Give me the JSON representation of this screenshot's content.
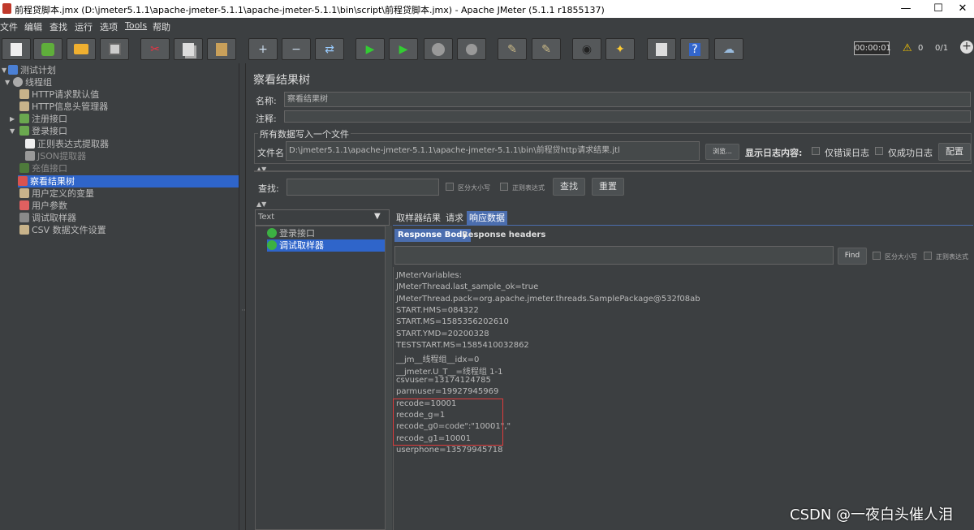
{
  "window": {
    "title": "前程贷脚本.jmx (D:\\jmeter5.1.1\\apache-jmeter-5.1.1\\apache-jmeter-5.1.1\\bin\\script\\前程贷脚本.jmx) - Apache JMeter (5.1.1 r1855137)",
    "minimize": "—",
    "maximize": "☐",
    "close": "✕"
  },
  "menu": [
    "文件",
    "编辑",
    "查找",
    "运行",
    "选项",
    "Tools",
    "帮助"
  ],
  "toolbar": {
    "timer": "00:00:01",
    "warning_count": "0",
    "threads": "0/1"
  },
  "tree": {
    "items": [
      {
        "label": "测试计划"
      },
      {
        "label": "线程组"
      },
      {
        "label": "HTTP请求默认值"
      },
      {
        "label": "HTTP信息头管理器"
      },
      {
        "label": "注册接口"
      },
      {
        "label": "登录接口"
      },
      {
        "label": "正则表达式提取器"
      },
      {
        "label": "JSON提取器"
      },
      {
        "label": "充值接口"
      },
      {
        "label": "察看结果树"
      },
      {
        "label": "用户定义的变量"
      },
      {
        "label": "用户参数"
      },
      {
        "label": "调试取样器"
      },
      {
        "label": "CSV 数据文件设置"
      }
    ]
  },
  "panel": {
    "title": "察看结果树",
    "name_label": "名称:",
    "name_value": "察看结果树",
    "comment_label": "注释:",
    "file_group_label": "所有数据写入一个文件",
    "file_label": "文件名",
    "file_value": "D:\\jmeter5.1.1\\apache-jmeter-5.1.1\\apache-jmeter-5.1.1\\bin\\前程贷http请求结果.jtl",
    "browse_button": "浏览...",
    "log_label": "显示日志内容:",
    "errors_only": "仅错误日志",
    "success_only": "仅成功日志",
    "configure_button": "配置"
  },
  "search": {
    "label": "查找:",
    "case_sensitive": "区分大小写",
    "regex": "正则表达式",
    "find_button": "查找",
    "reset_button": "重置"
  },
  "renderer": {
    "selected": "Text"
  },
  "results": {
    "items": [
      {
        "label": "登录接口"
      },
      {
        "label": "调试取样器"
      }
    ]
  },
  "tabs": {
    "sampler_result": "取样器结果",
    "request": "请求",
    "response_data": "响应数据"
  },
  "subtabs": {
    "body": "Response Body",
    "headers": "Response headers"
  },
  "response_search": {
    "find_button": "Find",
    "case_sensitive": "区分大小写",
    "regex": "正则表达式"
  },
  "response_lines": [
    "JMeterVariables:",
    "JMeterThread.last_sample_ok=true",
    "JMeterThread.pack=org.apache.jmeter.threads.SamplePackage@532f08ab",
    "START.HMS=084322",
    "START.MS=1585356202610",
    "START.YMD=20200328",
    "TESTSTART.MS=1585410032862",
    "__jm__线程组__idx=0",
    "__jmeter.U_T__=线程组 1-1",
    "csvuser=13174124785",
    "parmuser=19927945969",
    "recode=10001",
    "recode_g=1",
    "recode_g0=code\":\"10001\",\"",
    "recode_g1=10001",
    "userphone=13579945718"
  ],
  "watermark": "CSDN @一夜白头催人泪"
}
